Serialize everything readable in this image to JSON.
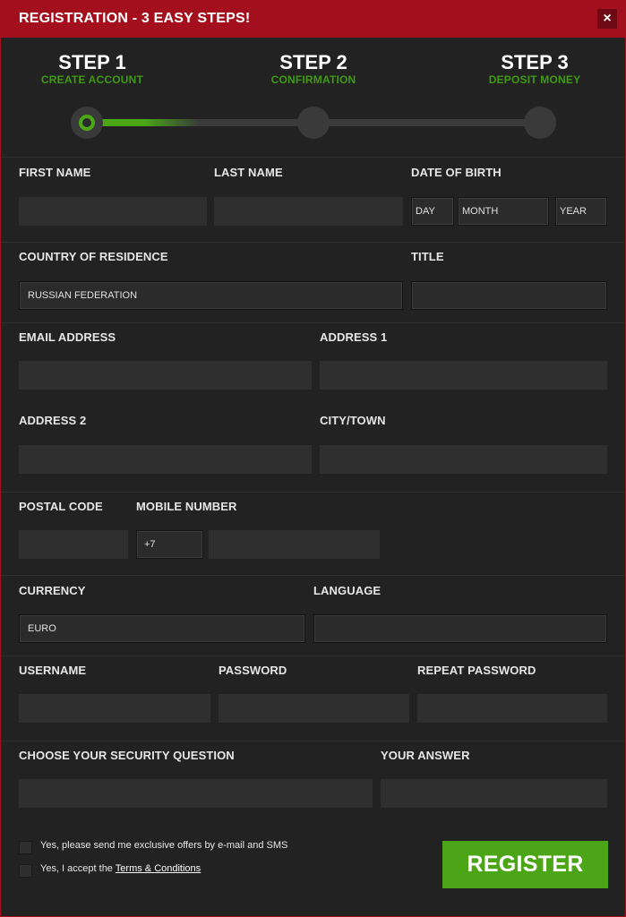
{
  "header": {
    "title": "REGISTRATION - 3 EASY STEPS!",
    "close_icon": "close-icon",
    "close_glyph": "×"
  },
  "steps": [
    {
      "number": "STEP 1",
      "label": "CREATE ACCOUNT"
    },
    {
      "number": "STEP 2",
      "label": "CONFIRMATION"
    },
    {
      "number": "STEP 3",
      "label": "DEPOSIT MONEY"
    }
  ],
  "progress": {
    "current_step": 1,
    "total_steps": 3,
    "fill_fraction": 0.25,
    "accent_color": "#4aa817"
  },
  "fields": {
    "first_name": {
      "label": "FIRST NAME",
      "value": ""
    },
    "last_name": {
      "label": "LAST NAME",
      "value": ""
    },
    "dob": {
      "label": "DATE OF BIRTH",
      "day": "DAY",
      "month": "MONTH",
      "year": "YEAR"
    },
    "country": {
      "label": "COUNTRY OF RESIDENCE",
      "value": "RUSSIAN FEDERATION"
    },
    "title": {
      "label": "TITLE",
      "value": ""
    },
    "email": {
      "label": "EMAIL ADDRESS",
      "value": ""
    },
    "address1": {
      "label": "ADDRESS 1",
      "value": ""
    },
    "address2": {
      "label": "ADDRESS 2",
      "value": ""
    },
    "city": {
      "label": "CITY/TOWN",
      "value": ""
    },
    "postal_code": {
      "label": "POSTAL CODE",
      "value": ""
    },
    "mobile": {
      "label": "MOBILE NUMBER",
      "prefix": "+7",
      "value": ""
    },
    "currency": {
      "label": "CURRENCY",
      "value": "EURO"
    },
    "language": {
      "label": "LANGUAGE",
      "value": ""
    },
    "username": {
      "label": "USERNAME",
      "value": ""
    },
    "password": {
      "label": "PASSWORD",
      "value": ""
    },
    "repeat_password": {
      "label": "REPEAT PASSWORD",
      "value": ""
    },
    "security_question": {
      "label": "CHOOSE YOUR SECURITY QUESTION",
      "value": ""
    },
    "answer": {
      "label": "YOUR ANSWER",
      "value": ""
    }
  },
  "checkboxes": {
    "offers": "Yes, please send me exclusive offers by e-mail and SMS",
    "terms_prefix": "Yes, I accept the ",
    "terms_link": "Terms & Conditions"
  },
  "register_label": "REGISTER",
  "colors": {
    "brand_red": "#a30f1c",
    "accent_green": "#4ca516",
    "background": "#222222"
  }
}
